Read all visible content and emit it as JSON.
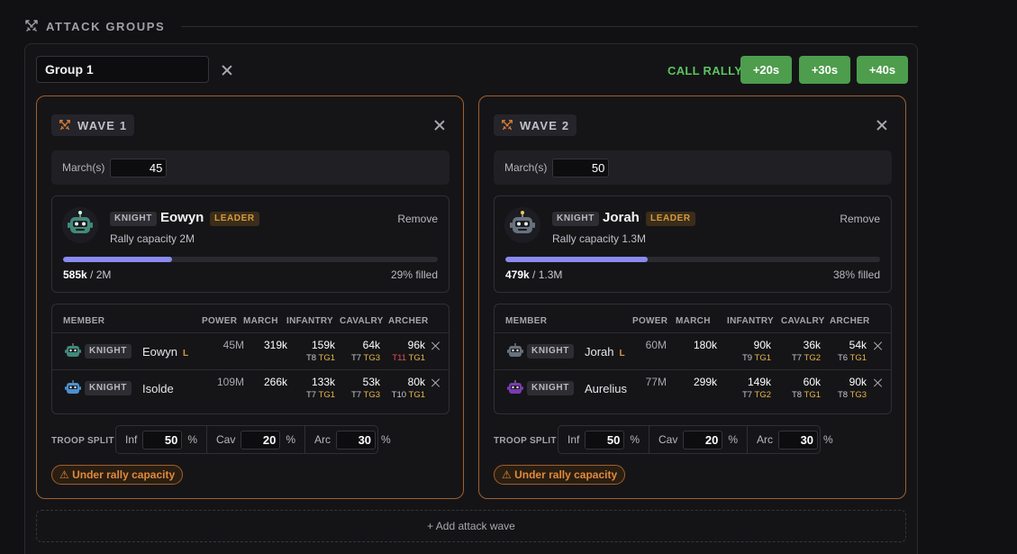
{
  "section": {
    "title": "ATTACK GROUPS",
    "icon": "crossed-swords-icon"
  },
  "group": {
    "name": "Group 1"
  },
  "rally": {
    "label": "CALL RALLY",
    "buttons": [
      "+20s",
      "+30s",
      "+40s"
    ]
  },
  "headers": {
    "member": "MEMBER",
    "power": "POWER",
    "march": "MARCH",
    "infantry": "INFANTRY",
    "cavalry": "CAVALRY",
    "archer": "ARCHER"
  },
  "labels": {
    "marches": "March(s)",
    "troop_split": "TROOP SPLIT",
    "inf": "Inf",
    "cav": "Cav",
    "arc": "Arc",
    "percent": "%",
    "remove": "Remove",
    "leader_tag": "LEADER",
    "leader_mark": "L"
  },
  "colors": {
    "accent_orange": "#a0602b",
    "green": "#4d9d4d",
    "progress": "#8a8af0"
  },
  "waves": [
    {
      "label": "WAVE 1",
      "marches": "45",
      "leader": {
        "tag": "KNIGHT",
        "name": "Eowyn",
        "capacity": "Rally capacity 2M",
        "amount": "585k",
        "amount_total": " / 2M",
        "filled": "29% filled",
        "fill_fraction": 0.29
      },
      "members": [
        {
          "tag": "KNIGHT",
          "name": "Eowyn",
          "leader": true,
          "power": "45M",
          "march": "319k",
          "infantry": "159k",
          "inf_tier": "T8",
          "inf_tg": "TG1",
          "cavalry": "64k",
          "cav_tier": "T7",
          "cav_tg": "TG3",
          "archer": "96k",
          "arc_tier": "T11",
          "arc_tg": "TG1"
        },
        {
          "tag": "KNIGHT",
          "name": "Isolde",
          "leader": false,
          "power": "109M",
          "march": "266k",
          "infantry": "133k",
          "inf_tier": "T7",
          "inf_tg": "TG1",
          "cavalry": "53k",
          "cav_tier": "T7",
          "cav_tg": "TG3",
          "archer": "80k",
          "arc_tier": "T10",
          "arc_tg": "TG1"
        }
      ],
      "split": {
        "inf": "50",
        "cav": "20",
        "arc": "30"
      },
      "warning": "⚠ Under rally capacity"
    },
    {
      "label": "WAVE 2",
      "marches": "50",
      "leader": {
        "tag": "KNIGHT",
        "name": "Jorah",
        "capacity": "Rally capacity 1.3M",
        "amount": "479k",
        "amount_total": " / 1.3M",
        "filled": "38% filled",
        "fill_fraction": 0.38
      },
      "members": [
        {
          "tag": "KNIGHT",
          "name": "Jorah",
          "leader": true,
          "power": "60M",
          "march": "180k",
          "infantry": "90k",
          "inf_tier": "T9",
          "inf_tg": "TG1",
          "cavalry": "36k",
          "cav_tier": "T7",
          "cav_tg": "TG2",
          "archer": "54k",
          "arc_tier": "T6",
          "arc_tg": "TG1"
        },
        {
          "tag": "KNIGHT",
          "name": "Aurelius",
          "leader": false,
          "power": "77M",
          "march": "299k",
          "infantry": "149k",
          "inf_tier": "T7",
          "inf_tg": "TG2",
          "cavalry": "60k",
          "cav_tier": "T8",
          "cav_tg": "TG1",
          "archer": "90k",
          "arc_tier": "T8",
          "arc_tg": "TG3"
        }
      ],
      "split": {
        "inf": "50",
        "cav": "20",
        "arc": "30"
      },
      "warning": "⚠ Under rally capacity"
    }
  ],
  "add_wave": "+ Add attack wave"
}
